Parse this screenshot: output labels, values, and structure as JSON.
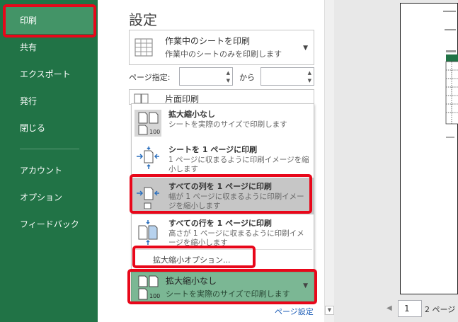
{
  "sidebar": {
    "items": [
      {
        "label": "印刷"
      },
      {
        "label": "共有"
      },
      {
        "label": "エクスポート"
      },
      {
        "label": "発行"
      },
      {
        "label": "閉じる"
      },
      {
        "label": "アカウント"
      },
      {
        "label": "オプション"
      },
      {
        "label": "フィードバック"
      }
    ]
  },
  "main": {
    "title": "設定",
    "print_what": {
      "label": "作業中のシートを印刷",
      "desc": "作業中のシートのみを印刷します"
    },
    "pages": {
      "label": "ページ指定:",
      "from": "",
      "to_label": "から",
      "to": ""
    },
    "sides": {
      "label": "片面印刷"
    },
    "scaling_options": [
      {
        "title": "拡大縮小なし",
        "desc": "シートを実際のサイズで印刷します",
        "icon_badge": "100"
      },
      {
        "title": "シートを 1 ページに印刷",
        "desc": "1 ページに収まるように印刷イメージを縮小します"
      },
      {
        "title": "すべての列を 1 ページに印刷",
        "desc": "幅が 1 ページに収まるように印刷イメージを縮小します"
      },
      {
        "title": "すべての行を 1 ページに印刷",
        "desc": "高さが 1 ページに収まるように印刷イメージを縮小します"
      }
    ],
    "custom_scaling": "拡大縮小オプション...",
    "current_scaling": {
      "title": "拡大縮小なし",
      "desc": "シートを実際のサイズで印刷します",
      "icon_badge": "100"
    },
    "page_setup": "ページ設定"
  },
  "preview": {
    "current_page": "1",
    "total_pages": "2 ページ"
  },
  "colors": {
    "sidebar_bg": "#217346",
    "highlight_red": "#e8071a",
    "selected_green": "#7bb794"
  }
}
